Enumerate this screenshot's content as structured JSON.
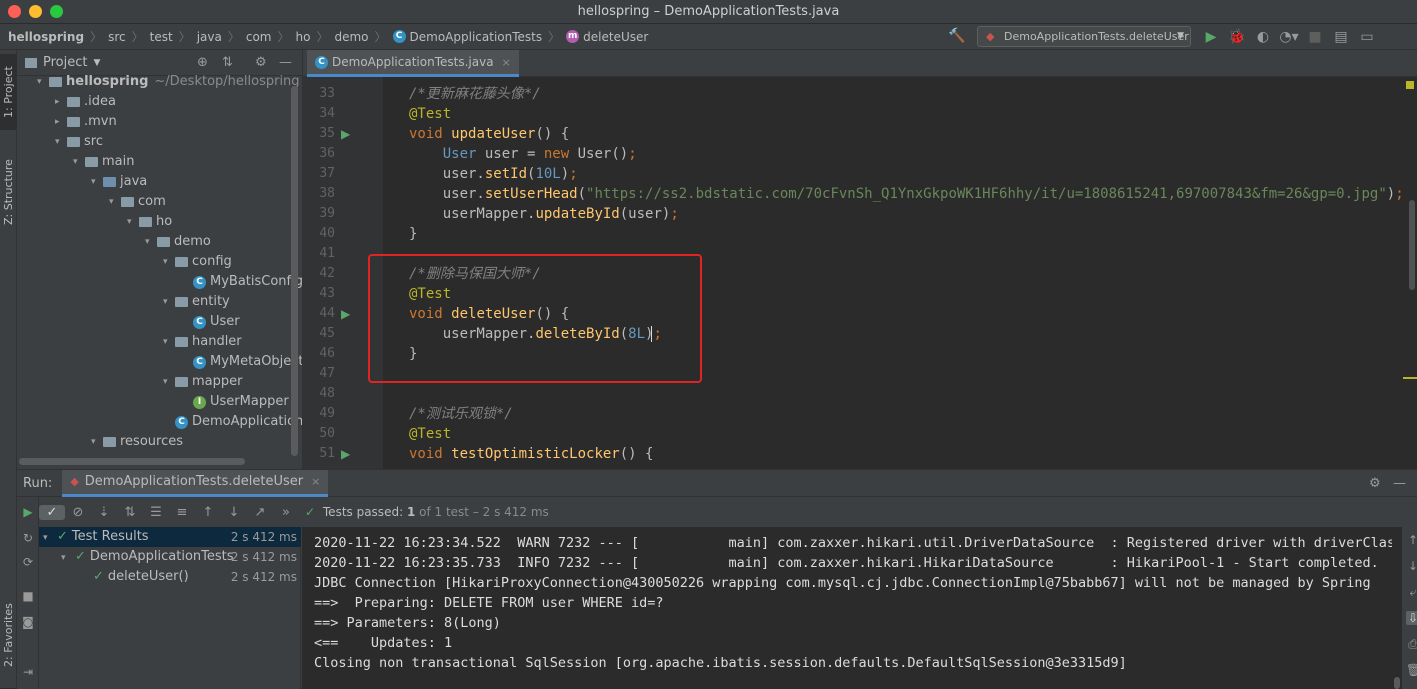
{
  "window": {
    "title": "hellospring – DemoApplicationTests.java",
    "traffic_light_colors": [
      "#fe5f57",
      "#febc2e",
      "#28c840"
    ]
  },
  "navbar": {
    "crumbs": [
      "hellospring",
      "src",
      "test",
      "java",
      "com",
      "ho",
      "demo",
      "DemoApplicationTests",
      "deleteUser"
    ],
    "run_config": "DemoApplicationTests.deleteUser"
  },
  "left_strip": {
    "project_tab": "1: Project",
    "structure_tab": "Z: Structure",
    "favorites_tab": "2: Favorites"
  },
  "project_panel": {
    "title": "Project",
    "tree": [
      {
        "label": "hellospring",
        "extra": "~/Desktop/hellospring",
        "depth": 0,
        "arrow": "▾",
        "type": "root"
      },
      {
        "label": ".idea",
        "depth": 1,
        "arrow": "▸",
        "type": "folder"
      },
      {
        "label": ".mvn",
        "depth": 1,
        "arrow": "▸",
        "type": "folder"
      },
      {
        "label": "src",
        "depth": 1,
        "arrow": "▾",
        "type": "folder"
      },
      {
        "label": "main",
        "depth": 2,
        "arrow": "▾",
        "type": "folder"
      },
      {
        "label": "java",
        "depth": 3,
        "arrow": "▾",
        "type": "folder-blue"
      },
      {
        "label": "com",
        "depth": 4,
        "arrow": "▾",
        "type": "folder"
      },
      {
        "label": "ho",
        "depth": 5,
        "arrow": "▾",
        "type": "folder"
      },
      {
        "label": "demo",
        "depth": 6,
        "arrow": "▾",
        "type": "folder"
      },
      {
        "label": "config",
        "depth": 7,
        "arrow": "▾",
        "type": "folder"
      },
      {
        "label": "MyBatisConfig",
        "depth": 8,
        "arrow": "",
        "type": "class"
      },
      {
        "label": "entity",
        "depth": 7,
        "arrow": "▾",
        "type": "folder"
      },
      {
        "label": "User",
        "depth": 8,
        "arrow": "",
        "type": "class"
      },
      {
        "label": "handler",
        "depth": 7,
        "arrow": "▾",
        "type": "folder"
      },
      {
        "label": "MyMetaObjectI",
        "depth": 8,
        "arrow": "",
        "type": "class"
      },
      {
        "label": "mapper",
        "depth": 7,
        "arrow": "▾",
        "type": "folder"
      },
      {
        "label": "UserMapper",
        "depth": 8,
        "arrow": "",
        "type": "interface"
      },
      {
        "label": "DemoApplication",
        "depth": 7,
        "arrow": "",
        "type": "class"
      },
      {
        "label": "resources",
        "depth": 3,
        "arrow": "▾",
        "type": "folder"
      }
    ]
  },
  "editor": {
    "tab_label": "DemoApplicationTests.java",
    "lines": [
      {
        "n": "33",
        "html": "<span class=\"cm\">/*更新麻花藤头像*/</span>"
      },
      {
        "n": "34",
        "html": "<span class=\"ann\">@Test</span>"
      },
      {
        "n": "35",
        "run": true,
        "html": "<span class=\"kw\">void</span> <span class=\"fn\">updateUser</span>() {"
      },
      {
        "n": "36",
        "html": "    <span class=\"num\">User</span> user = <span class=\"kw\">new</span> User()<span class=\"kw\">;</span>"
      },
      {
        "n": "37",
        "html": "    user.<span class=\"fn\">setId</span>(<span class=\"num\">10L</span>)<span class=\"kw\">;</span>"
      },
      {
        "n": "38",
        "html": "    user.<span class=\"fn\">setUserHead</span>(<span class=\"str\">\"https://ss2.bdstatic.com/70cFvnSh_Q1YnxGkpoWK1HF6hhy/it/u=1808615241,697007843&amp;fm=26&amp;gp=0.jpg\"</span>)<span class=\"kw\">;</span>"
      },
      {
        "n": "39",
        "html": "    userMapper.<span class=\"fn\">updateById</span>(user)<span class=\"kw\">;</span>"
      },
      {
        "n": "40",
        "html": "}"
      },
      {
        "n": "41",
        "html": ""
      },
      {
        "n": "42",
        "html": "<span class=\"cm\">/*删除马保国大师*/</span>"
      },
      {
        "n": "43",
        "html": "<span class=\"ann\">@Test</span>"
      },
      {
        "n": "44",
        "run": true,
        "html": "<span class=\"kw\">void</span> <span class=\"fn\">deleteUser</span>() {"
      },
      {
        "n": "45",
        "html": "    userMapper.<span class=\"fn\">deleteById</span>(<span class=\"num\">8L</span>)<span class=\"kw\">;</span>"
      },
      {
        "n": "46",
        "html": "}"
      },
      {
        "n": "47",
        "html": ""
      },
      {
        "n": "48",
        "html": ""
      },
      {
        "n": "49",
        "html": "<span class=\"cm\">/*测试乐观锁*/</span>"
      },
      {
        "n": "50",
        "html": "<span class=\"ann\">@Test</span>"
      },
      {
        "n": "51",
        "run": true,
        "html": "<span class=\"kw\">void</span> <span class=\"fn\">testOptimisticLocker</span>() {"
      }
    ]
  },
  "run_panel": {
    "label": "Run:",
    "tab": "DemoApplicationTests.deleteUser",
    "status_prefix": "Tests passed:",
    "status_count": "1",
    "status_rest": "of 1 test – 2 s 412 ms",
    "tree": [
      {
        "label": "Test Results",
        "time": "2 s 412 ms",
        "indent": 0,
        "arrow": "▾"
      },
      {
        "label": "DemoApplicationTests",
        "time": "2 s 412 ms",
        "indent": 1,
        "arrow": "▾"
      },
      {
        "label": "deleteUser()",
        "time": "2 s 412 ms",
        "indent": 2,
        "arrow": ""
      }
    ],
    "console": [
      "2020-11-22 16:23:34.522  WARN 7232 --- [           main] com.zaxxer.hikari.util.DriverDataSource  : Registered driver with driverClas",
      "2020-11-22 16:23:35.733  INFO 7232 --- [           main] com.zaxxer.hikari.HikariDataSource       : HikariPool-1 - Start completed.",
      "JDBC Connection [HikariProxyConnection@430050226 wrapping com.mysql.cj.jdbc.ConnectionImpl@75babb67] will not be managed by Spring",
      "==>  Preparing: DELETE FROM user WHERE id=?",
      "==> Parameters: 8(Long)",
      "<==    Updates: 1",
      "Closing non transactional SqlSession [org.apache.ibatis.session.defaults.DefaultSqlSession@3e3315d9]"
    ]
  }
}
